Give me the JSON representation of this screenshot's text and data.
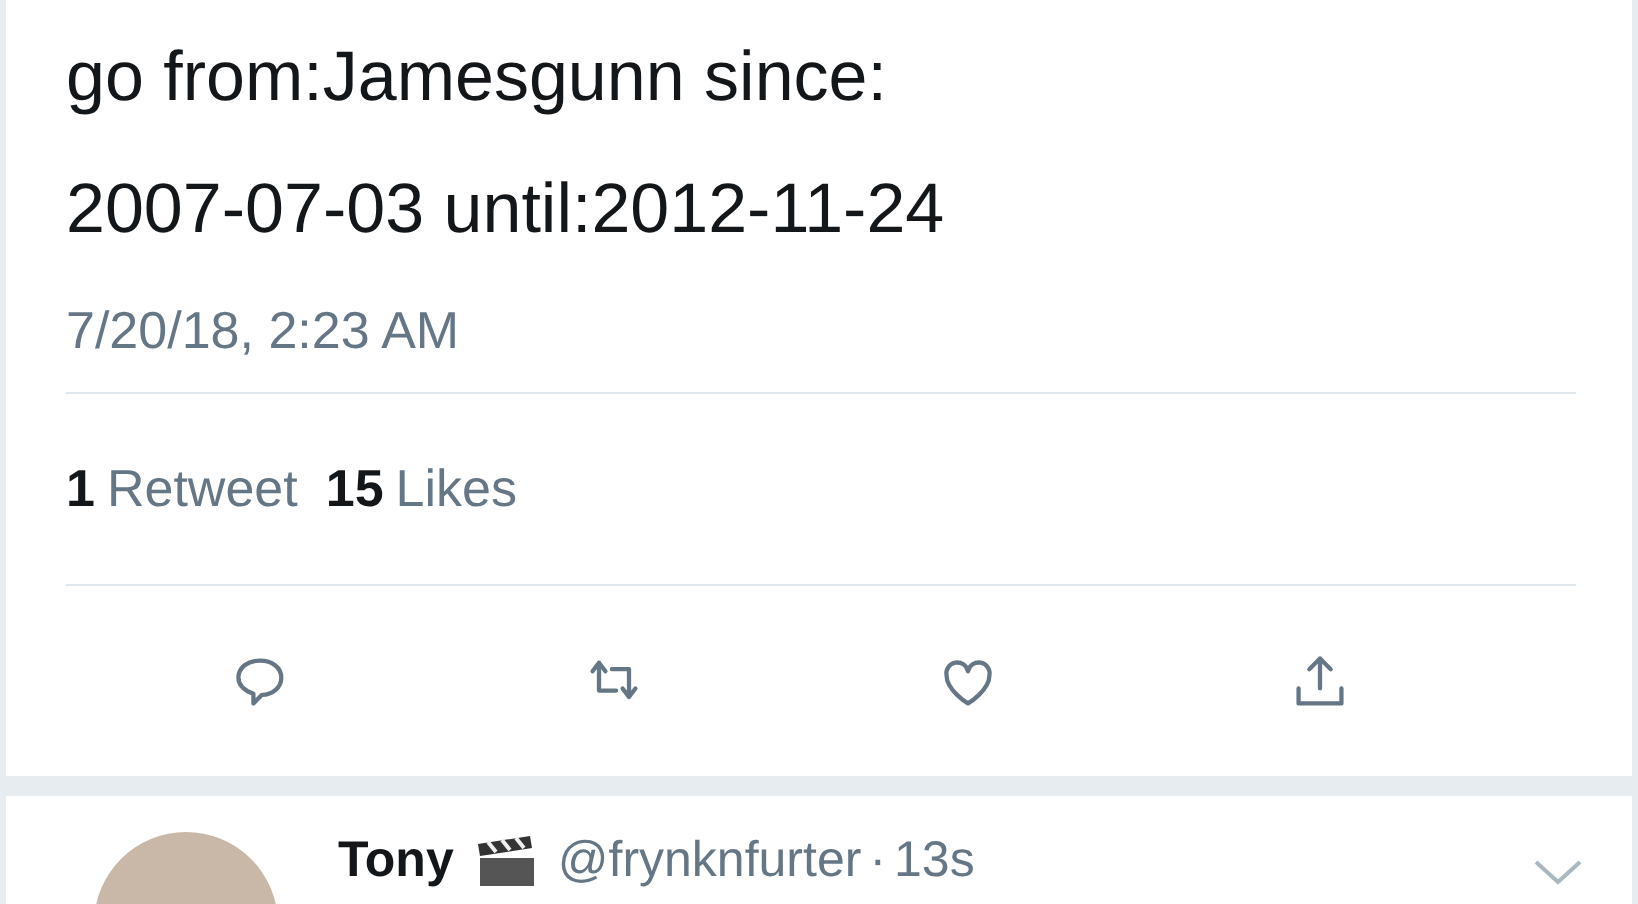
{
  "tweet": {
    "text_lines": [
      "go from:Jamesgunn since:",
      "2007-07-03 until:2012-11-24"
    ],
    "timestamp": "7/20/18, 2:23 AM"
  },
  "stats": [
    {
      "count": "1",
      "label": "Retweet"
    },
    {
      "count": "15",
      "label": "Likes"
    }
  ],
  "actions": [
    {
      "kind": "reply"
    },
    {
      "kind": "retweet"
    },
    {
      "kind": "like"
    },
    {
      "kind": "share"
    }
  ],
  "reply": {
    "name": "Tony",
    "handle": "@frynknfurter",
    "separator": "·",
    "time": "13s"
  }
}
